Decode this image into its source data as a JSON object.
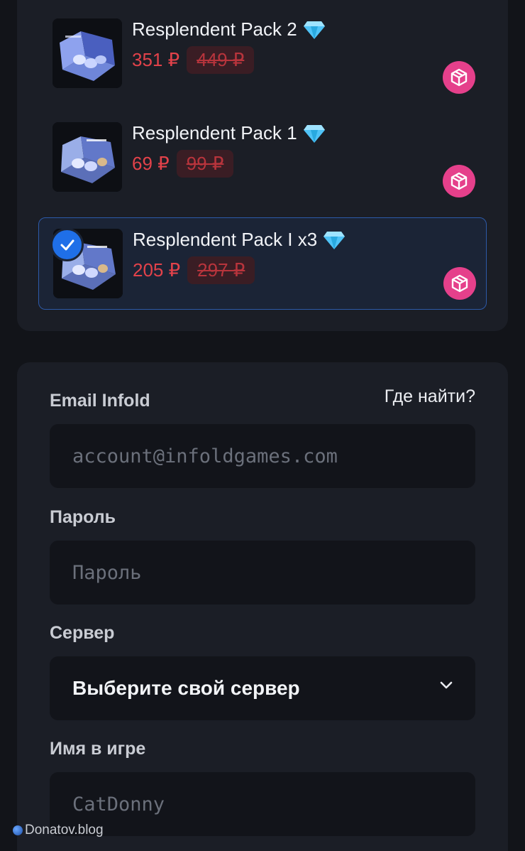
{
  "products": [
    {
      "title": "Resplendent Pack 2",
      "price": "351 ₽",
      "old_price": "449 ₽",
      "selected": false
    },
    {
      "title": "Resplendent Pack 1",
      "price": "69 ₽",
      "old_price": "99 ₽",
      "selected": false
    },
    {
      "title": "Resplendent Pack I x3",
      "price": "205 ₽",
      "old_price": "297 ₽",
      "selected": true
    }
  ],
  "form": {
    "email_label": "Email Infold",
    "help_link": "Где найти?",
    "email_placeholder": "account@infoldgames.com",
    "password_label": "Пароль",
    "password_placeholder": "Пароль",
    "server_label": "Сервер",
    "server_value": "Выберите свой сервер",
    "nickname_label": "Имя в игре",
    "nickname_placeholder": "CatDonny"
  },
  "watermark": "Donatov.blog",
  "colors": {
    "accent_price": "#e2424a",
    "cube_button": "#e5408b",
    "selected_check": "#1f6fe8",
    "selected_border": "#2d5aa8"
  },
  "icons": {
    "gem": "gem-icon",
    "cube": "cube-icon",
    "check": "check-icon",
    "chevron": "chevron-down-icon"
  }
}
